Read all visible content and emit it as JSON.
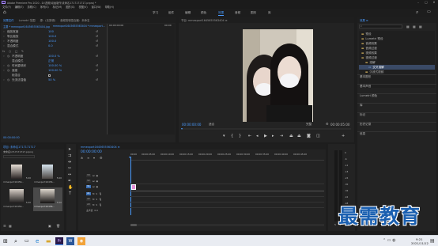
{
  "app": {
    "title": "Adobe Premiere Pro 2020 - D:\\视频\\动画制作\\未命名1717171717.prproj *",
    "menus": [
      "文件(F)",
      "编辑(E)",
      "剪辑(C)",
      "序列(S)",
      "标记(M)",
      "图形(G)",
      "视图(V)",
      "窗口(W)",
      "帮助(H)"
    ]
  },
  "workspaces": {
    "items": [
      "学习",
      "组件",
      "编辑",
      "颜色",
      "效果",
      "音频",
      "图形",
      "库"
    ],
    "active_index": 4
  },
  "effect_controls": {
    "tabs": [
      "效果控件",
      "Lumetri 范围",
      "源：(无剪辑)",
      "音频剪辑混合器：未命名"
    ],
    "active_tab_index": 0,
    "source_label": "主要 * mmexport1645655563404.jpg",
    "sequence_label": "mmexport1645655563404 * mmexport...",
    "rows": [
      {
        "label": "缩放宽度",
        "value": "100"
      },
      {
        "label": "等比缩放",
        "value": "100.0"
      },
      {
        "label": "不透明度",
        "value": "100.0"
      },
      {
        "label": "混合模式",
        "value": "0.0"
      },
      {
        "label": "fx",
        "value": ""
      },
      {
        "label": "圆",
        "value": ""
      },
      {
        "label": "不透明度",
        "value": "100.0 %"
      },
      {
        "label": "混合模式",
        "value": "正常"
      },
      {
        "label": "时间重映射",
        "value": "100.00 %"
      },
      {
        "label": "速度",
        "value": "100.00 %"
      },
      {
        "label": "帧混合",
        "value": ""
      },
      {
        "label": "光流法插值",
        "value": "50 %"
      }
    ],
    "timecode": "00:00:00:00"
  },
  "program_monitor": {
    "title": "节目: mmexport1645655563404 ≡",
    "timecode_left": "00:00:00:00",
    "fit": "适合",
    "quality": "完整",
    "timecode_right": "00:00:05:00"
  },
  "effects_panel": {
    "title": "效果 ≡",
    "tree": [
      "预设",
      "Lumetri 预设",
      "音频效果",
      "音频过渡",
      "视频效果",
      "视频过渡",
      "溶解",
      "交叉溶解",
      "沉浸式视频"
    ],
    "sections": [
      "基本图形",
      "基本声音",
      "Lumetri 颜色",
      "库",
      "标记",
      "历史记录",
      "信息"
    ]
  },
  "project_panel": {
    "title": "项目: 未命名1717171717",
    "file": "未命名1717171717.prproj",
    "items": [
      {
        "name": "mmexport16456...",
        "duration": "5:00"
      },
      {
        "name": "mmexport16456...",
        "duration": "5:00"
      },
      {
        "name": "mmexport16456...",
        "duration": "5:00"
      },
      {
        "name": "mmexport16456...",
        "duration": "5:00"
      }
    ]
  },
  "timeline": {
    "title": "mmexport1645655563404 ≡",
    "timecode": "00:00:00:00",
    "ruler": [
      "00:00",
      "00:00:05:00",
      "00:00:10:00",
      "00:00:15:00",
      "00:00:20:00",
      "00:00:25:00",
      "00:00:30:00",
      "00:00:35:00",
      "00:00:40:00",
      "00:00:45:00"
    ],
    "tracks": [
      "V3",
      "V2",
      "V1",
      "A1",
      "A2",
      "A3",
      "主声道"
    ]
  },
  "taskbar": {
    "time": "9:21",
    "date": "2021/11/12"
  },
  "watermark": "最需教育",
  "colors": {
    "accent": "#4a9bff",
    "playhead": "#e06666",
    "clip": "#e58fd6"
  }
}
